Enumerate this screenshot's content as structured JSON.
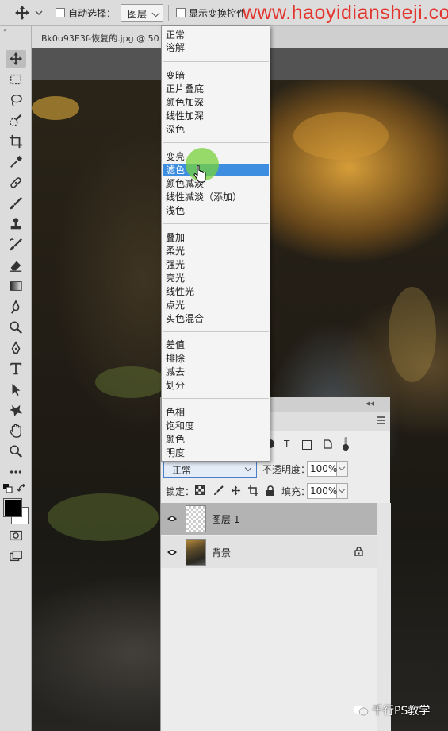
{
  "options_bar": {
    "auto_select_label": "自动选择：",
    "auto_select_value": "图层",
    "show_transform_label": "显示变换控件",
    "watermark": "www.haoyidiansheji.com"
  },
  "document": {
    "tab_title": "Bk0u93E3f-恢复的.jpg @ 50"
  },
  "blend_menu": {
    "groups": [
      [
        "正常",
        "溶解"
      ],
      [
        "变暗",
        "正片叠底",
        "颜色加深",
        "线性加深",
        "深色"
      ],
      [
        "变亮",
        "滤色",
        "颜色减淡",
        "线性减淡（添加）",
        "浅色"
      ],
      [
        "叠加",
        "柔光",
        "强光",
        "亮光",
        "线性光",
        "点光",
        "实色混合"
      ],
      [
        "差值",
        "排除",
        "减去",
        "划分"
      ],
      [
        "色相",
        "饱和度",
        "颜色",
        "明度"
      ]
    ],
    "highlighted": "滤色"
  },
  "layers_panel": {
    "collapse_glyph": "◂◂",
    "blend_mode": "正常",
    "opacity_label": "不透明度：",
    "opacity_value": "100%",
    "lock_label": "锁定：",
    "fill_label": "填充：",
    "fill_value": "100%",
    "layers": [
      {
        "name": "图层 1",
        "selected": true,
        "locked": false
      },
      {
        "name": "背景",
        "selected": false,
        "locked": true
      }
    ]
  },
  "footer_watermark": "千行PS教学",
  "colors": {
    "highlight": "#3d8ee0",
    "panel_bg": "#ececec",
    "watermark": "#e2352e"
  }
}
